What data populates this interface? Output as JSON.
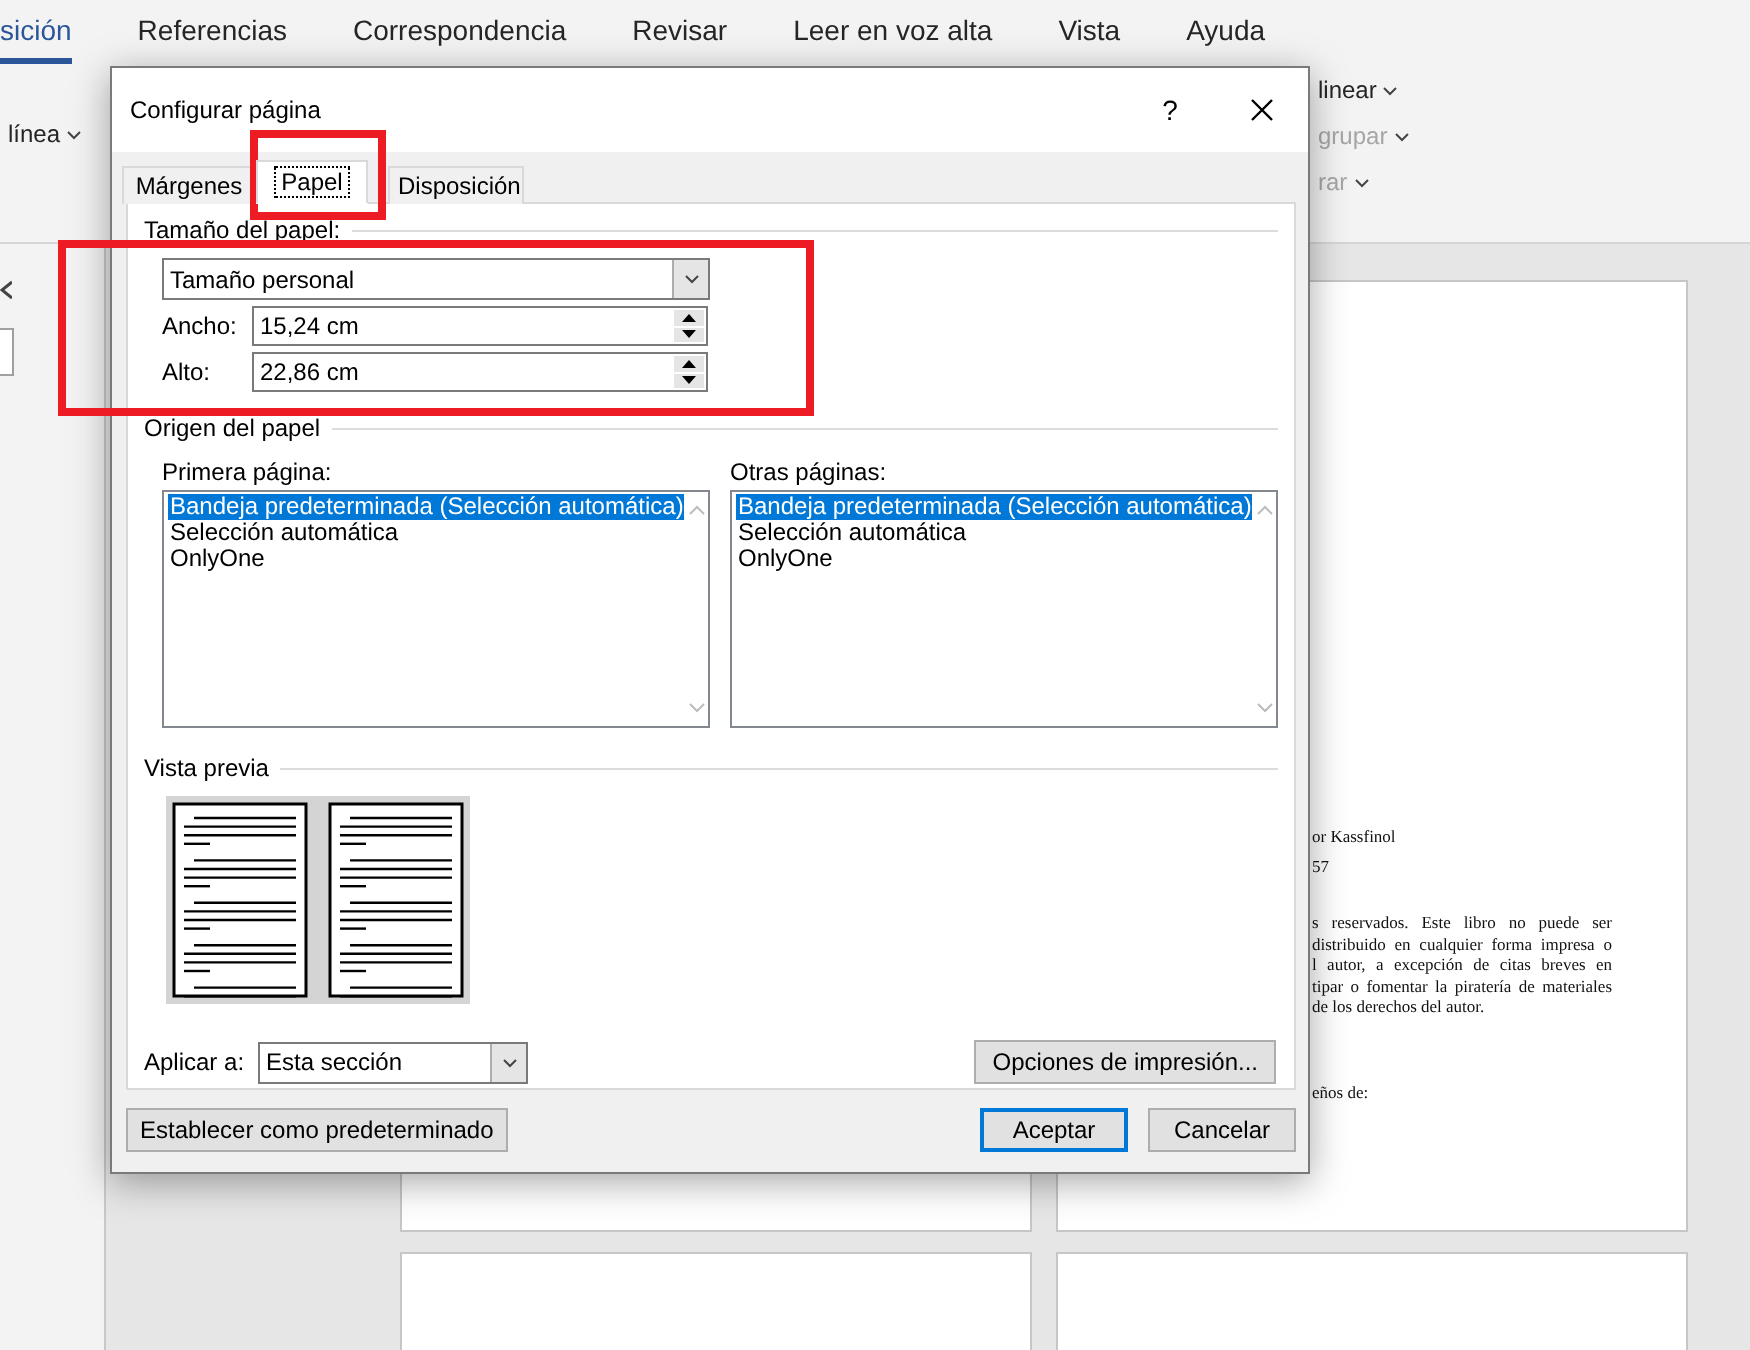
{
  "ribbon": {
    "tabs": [
      {
        "label": "sición",
        "selected": true
      },
      {
        "label": "Referencias",
        "selected": false
      },
      {
        "label": "Correspondencia",
        "selected": false
      },
      {
        "label": "Revisar",
        "selected": false
      },
      {
        "label": "Leer en voz alta",
        "selected": false
      },
      {
        "label": "Vista",
        "selected": false
      },
      {
        "label": "Ayuda",
        "selected": false
      }
    ],
    "left_commands": [
      {
        "label": "línea",
        "disabled": false
      }
    ],
    "right_commands": [
      {
        "label": "linear",
        "disabled": false
      },
      {
        "label": "grupar",
        "disabled": true
      },
      {
        "label": "rar",
        "disabled": true
      }
    ]
  },
  "document": {
    "lines": [
      {
        "text": "or Kassfinol",
        "justify": false
      },
      {
        "text": "57"
      },
      {
        "text": "s reservados. Este libro no puede ser",
        "justify": true
      },
      {
        "text": "distribuido en cualquier forma impresa o",
        "justify": true
      },
      {
        "text": "l autor, a excepción de citas breves en",
        "justify": true
      },
      {
        "text": "tipar o fomentar la piratería de materiales",
        "justify": true
      },
      {
        "text": "de los derechos del autor.",
        "justify": false
      }
    ],
    "closing": "eños de:"
  },
  "dialog": {
    "title": "Configurar página",
    "help": "?",
    "tabs": [
      {
        "label": "Márgenes",
        "selected": false
      },
      {
        "label": "Papel",
        "selected": true
      },
      {
        "label": "Disposición",
        "selected": false
      }
    ],
    "paper_size": {
      "heading": "Tamaño del papel:",
      "value": "Tamaño personal",
      "fields": [
        {
          "label": "Ancho:",
          "value": "15,24 cm"
        },
        {
          "label": "Alto:",
          "value": "22,86 cm"
        }
      ]
    },
    "paper_source": {
      "heading": "Origen del papel",
      "lists": [
        {
          "label": "Primera página:",
          "items": [
            {
              "text": "Bandeja predeterminada (Selección automática)",
              "selected": true
            },
            {
              "text": "Selección automática",
              "selected": false
            },
            {
              "text": "OnlyOne",
              "selected": false
            }
          ]
        },
        {
          "label": "Otras páginas:",
          "items": [
            {
              "text": "Bandeja predeterminada (Selección automática)",
              "selected": true
            },
            {
              "text": "Selección automática",
              "selected": false
            },
            {
              "text": "OnlyOne",
              "selected": false
            }
          ]
        }
      ]
    },
    "preview": {
      "heading": "Vista previa"
    },
    "apply_to": {
      "label": "Aplicar a:",
      "value": "Esta sección"
    },
    "print_options": "Opciones de impresión...",
    "buttons": [
      {
        "label": "Establecer como predeterminado",
        "kind": "secondary"
      },
      {
        "label": "Aceptar",
        "kind": "default"
      },
      {
        "label": "Cancelar",
        "kind": "secondary"
      }
    ]
  }
}
